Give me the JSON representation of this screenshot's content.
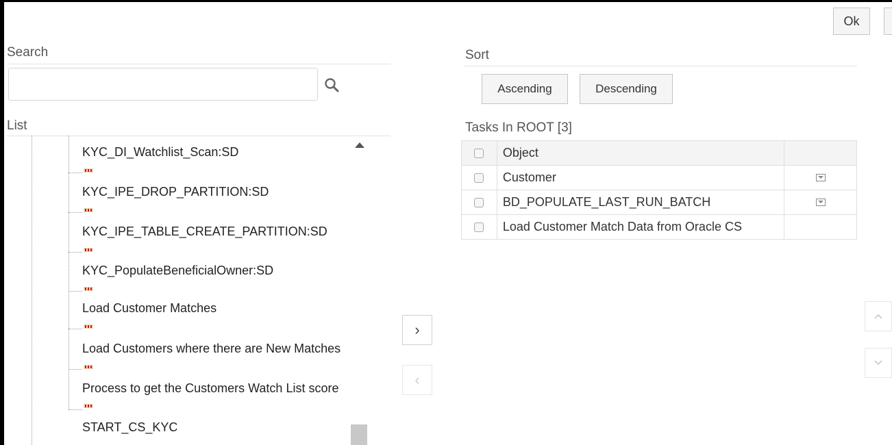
{
  "toolbar": {
    "ok_label": "Ok"
  },
  "search": {
    "title": "Search",
    "value": "",
    "placeholder": ""
  },
  "list": {
    "title": "List",
    "items": [
      "KYC_DI_Watchlist_Scan:SD",
      "KYC_IPE_DROP_PARTITION:SD",
      "KYC_IPE_TABLE_CREATE_PARTITION:SD",
      "KYC_PopulateBeneficialOwner:SD",
      "Load Customer Matches",
      "Load Customers where there are New Matches",
      "Process to get the Customers Watch List score",
      "START_CS_KYC"
    ]
  },
  "transfer": {
    "add_label": "›",
    "remove_label": "‹"
  },
  "sort": {
    "title": "Sort",
    "ascending_label": "Ascending",
    "descending_label": "Descending"
  },
  "tasks": {
    "title": "Tasks In ROOT [3]",
    "header_object": "Object",
    "rows": [
      {
        "object": "Customer",
        "has_icon": true
      },
      {
        "object": "BD_POPULATE_LAST_RUN_BATCH",
        "has_icon": true
      },
      {
        "object": "Load Customer Match Data from Oracle CS",
        "has_icon": false
      }
    ]
  },
  "reorder": {
    "up_label": "^",
    "down_label": "v"
  }
}
